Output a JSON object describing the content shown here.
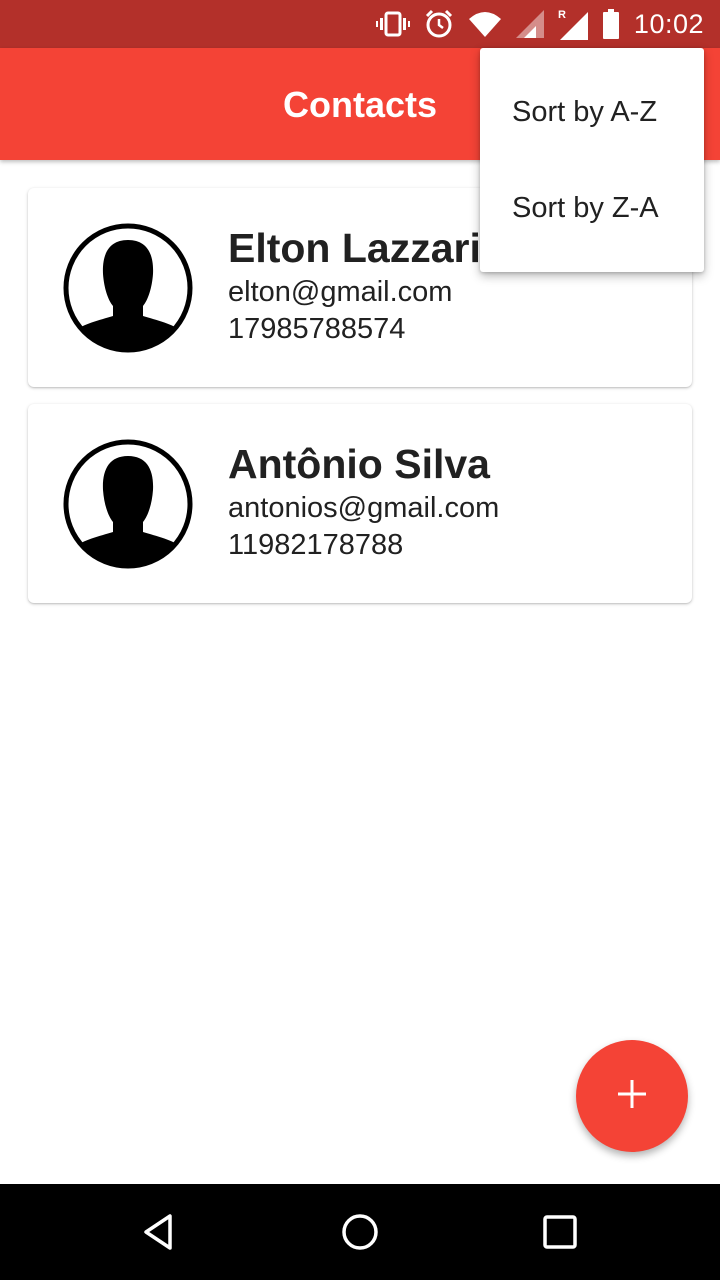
{
  "status_bar": {
    "time": "10:02",
    "icons": [
      "vibrate-icon",
      "alarm-icon",
      "wifi-icon",
      "signal-icon",
      "roaming-signal-icon",
      "battery-icon"
    ],
    "background": "#b3302a"
  },
  "app_bar": {
    "title": "Contacts",
    "background": "#f44336"
  },
  "overflow_menu": {
    "items": [
      {
        "label": "Sort by A-Z"
      },
      {
        "label": "Sort by Z-A"
      }
    ]
  },
  "contacts": [
    {
      "name": "Elton Lazzari",
      "email": "elton@gmail.com",
      "phone": "17985788574",
      "avatar_icon": "person-silhouette-icon"
    },
    {
      "name": "Antônio Silva",
      "email": "antonios@gmail.com",
      "phone": "11982178788",
      "avatar_icon": "person-silhouette-icon"
    }
  ],
  "fab": {
    "icon": "plus-icon",
    "color": "#f44336"
  },
  "nav_bar": {
    "icons": [
      "back-icon",
      "home-icon",
      "recents-icon"
    ]
  }
}
